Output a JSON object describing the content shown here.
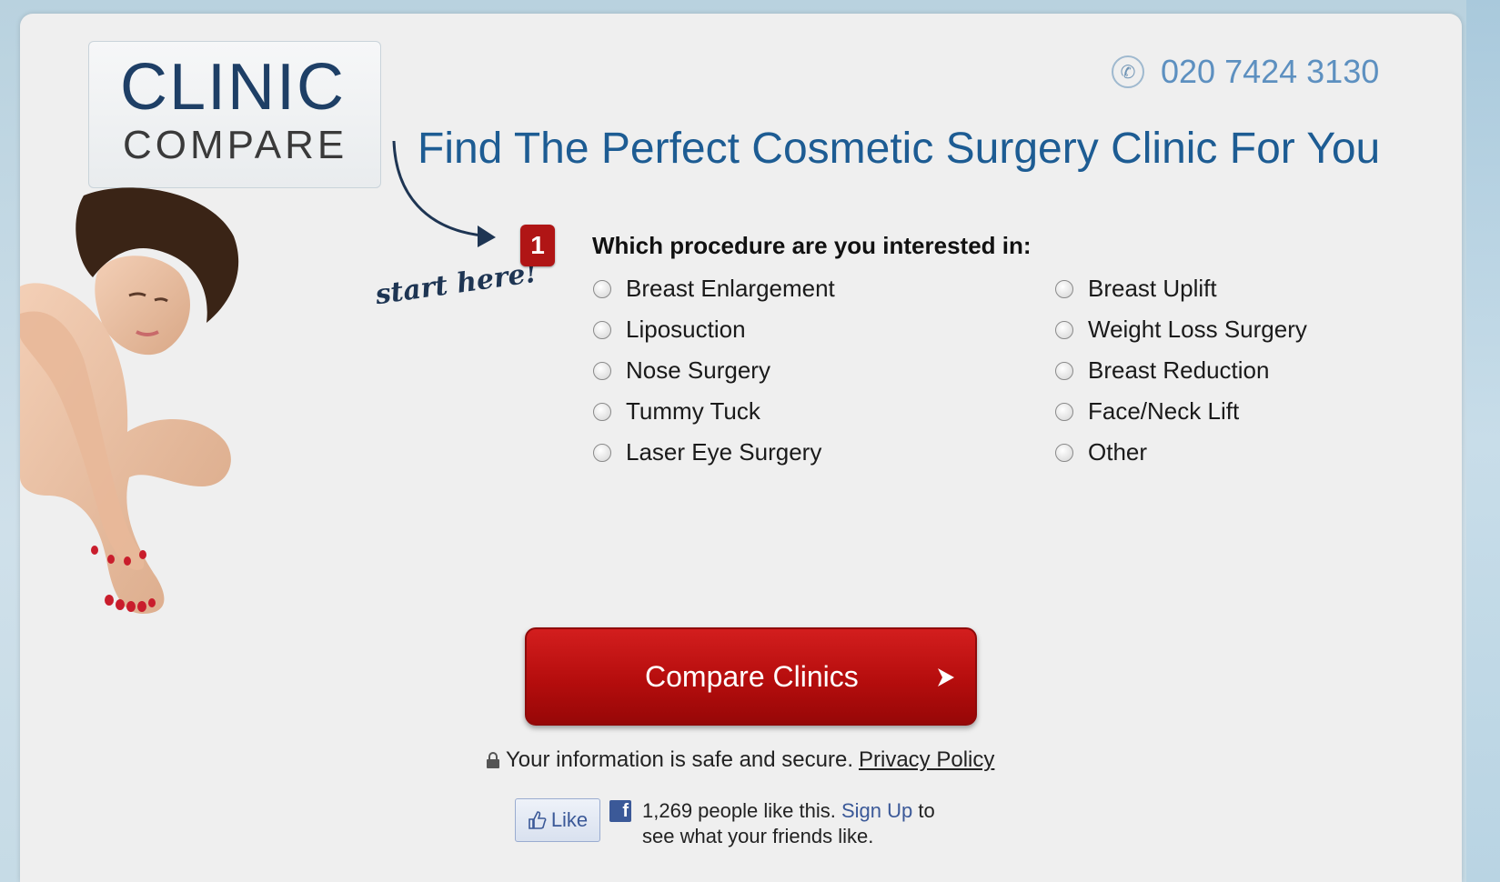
{
  "logo": {
    "line1": "CLINIC",
    "line2": "COMPARE"
  },
  "phone": {
    "number": "020 7424 3130",
    "icon": "phone-icon"
  },
  "headline": "Find The Perfect Cosmetic Surgery Clinic For You",
  "start_here": "start here!",
  "step": {
    "number": "1",
    "question": "Which procedure are you interested in:"
  },
  "options": [
    "Breast Enlargement",
    "Liposuction",
    "Nose Surgery",
    "Tummy Tuck",
    "Laser Eye Surgery",
    "Breast Uplift",
    "Weight Loss Surgery",
    "Breast Reduction",
    "Face/Neck Lift",
    "Other"
  ],
  "cta": {
    "label": "Compare Clinics"
  },
  "secure": {
    "text": "Your information is safe and secure.",
    "privacy_link": "Privacy Policy"
  },
  "facebook": {
    "like_label": "Like",
    "count_text": "1,269 people like this.",
    "signup": "Sign Up",
    "rest": "to see what your friends like."
  },
  "colors": {
    "brand_red": "#b50d0d",
    "headline_blue": "#1d5c93",
    "facebook_blue": "#3b5998"
  }
}
